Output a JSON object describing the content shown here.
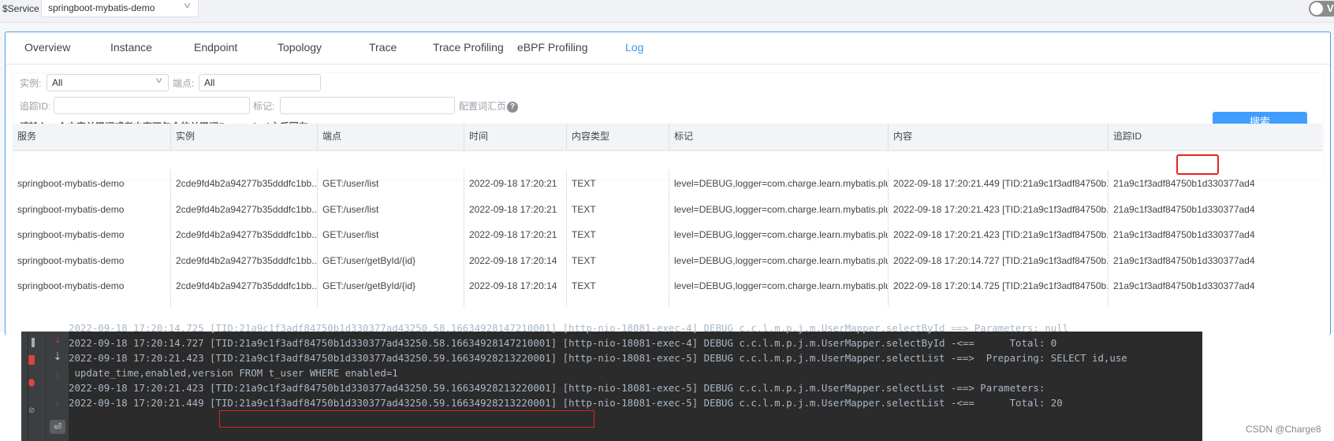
{
  "topbar": {
    "service_label": "$Service",
    "service_value": "springboot-mybatis-demo",
    "toggle_text": "V"
  },
  "tabs": [
    {
      "label": "Overview",
      "active": false
    },
    {
      "label": "Instance",
      "active": false
    },
    {
      "label": "Endpoint",
      "active": false
    },
    {
      "label": "Topology",
      "active": false
    },
    {
      "label": "Trace",
      "active": false
    },
    {
      "label": "Trace Profiling",
      "active": false
    },
    {
      "label": "eBPF Profiling",
      "active": false
    },
    {
      "label": "Log",
      "active": true
    }
  ],
  "accent_color": "#409eff",
  "filters": {
    "instance_label": "实例:",
    "instance_value": "All",
    "endpoint_label": "端点:",
    "endpoint_value": "All",
    "trace_id_label": "追踪ID:",
    "trace_id_value": "",
    "tag_label": "标记:",
    "tag_value": "",
    "vocab_link": "配置词汇页",
    "help_icon": "?",
    "hint": "请输入一个内容关键词或者内容不包含的关键词(key=value)之后回车",
    "search_button": "搜索"
  },
  "table": {
    "columns": [
      "服务",
      "实例",
      "端点",
      "时间",
      "内容类型",
      "标记",
      "内容",
      "追踪ID"
    ],
    "rows": [
      [
        "springboot-mybatis-demo",
        "2cde9fd4b2a94277b35dddfc1bb...",
        "GET:/user/list",
        "2022-09-18 17:20:21",
        "TEXT",
        "level=DEBUG,logger=com.charge.learn.mybatis.plu...",
        "2022-09-18 17:20:21.449 [TID:21a9c1f3adf84750b...",
        "21a9c1f3adf84750b1d330377ad4"
      ],
      [
        "springboot-mybatis-demo",
        "2cde9fd4b2a94277b35dddfc1bb...",
        "GET:/user/list",
        "2022-09-18 17:20:21",
        "TEXT",
        "level=DEBUG,logger=com.charge.learn.mybatis.plu...",
        "2022-09-18 17:20:21.423 [TID:21a9c1f3adf84750b...",
        "21a9c1f3adf84750b1d330377ad4"
      ],
      [
        "springboot-mybatis-demo",
        "2cde9fd4b2a94277b35dddfc1bb...",
        "GET:/user/list",
        "2022-09-18 17:20:21",
        "TEXT",
        "level=DEBUG,logger=com.charge.learn.mybatis.plu...",
        "2022-09-18 17:20:21.423 [TID:21a9c1f3adf84750b...",
        "21a9c1f3adf84750b1d330377ad4"
      ],
      [
        "springboot-mybatis-demo",
        "2cde9fd4b2a94277b35dddfc1bb...",
        "GET:/user/getById/{id}",
        "2022-09-18 17:20:14",
        "TEXT",
        "level=DEBUG,logger=com.charge.learn.mybatis.plu...",
        "2022-09-18 17:20:14.727 [TID:21a9c1f3adf84750b...",
        "21a9c1f3adf84750b1d330377ad4"
      ],
      [
        "springboot-mybatis-demo",
        "2cde9fd4b2a94277b35dddfc1bb...",
        "GET:/user/getById/{id}",
        "2022-09-18 17:20:14",
        "TEXT",
        "level=DEBUG,logger=com.charge.learn.mybatis.plu...",
        "2022-09-18 17:20:14.725 [TID:21a9c1f3adf84750b...",
        "21a9c1f3adf84750b1d330377ad4"
      ]
    ]
  },
  "console": {
    "lines": [
      "2022-09-18 17:20:14.725 [TID:21a9c1f3adf84750b1d330377ad43250.58.16634928147210001] [http-nio-18081-exec-4] DEBUG c.c.l.m.p.j.m.UserMapper.selectById ==> Parameters: null",
      "2022-09-18 17:20:14.727 [TID:21a9c1f3adf84750b1d330377ad43250.58.16634928147210001] [http-nio-18081-exec-4] DEBUG c.c.l.m.p.j.m.UserMapper.selectById -<==      Total: 0",
      "2022-09-18 17:20:21.423 [TID:21a9c1f3adf84750b1d330377ad43250.59.16634928213220001] [http-nio-18081-exec-5] DEBUG c.c.l.m.p.j.m.UserMapper.selectList -==>  Preparing: SELECT id,use",
      " update_time,enabled,version FROM t_user WHERE enabled=1",
      "2022-09-18 17:20:21.423 [TID:21a9c1f3adf84750b1d330377ad43250.59.16634928213220001] [http-nio-18081-exec-5] DEBUG c.c.l.m.p.j.m.UserMapper.selectList -==> Parameters: ",
      "2022-09-18 17:20:21.449 [TID:21a9c1f3adf84750b1d330377ad43250.59.16634928213220001] [http-nio-18081-exec-5] DEBUG c.c.l.m.p.j.m.UserMapper.selectList -<==      Total: 20"
    ],
    "gutter_icons": [
      "scroll-down-arrow",
      "sort-down",
      "up-arrow",
      "down-arrow",
      "soft-wrap"
    ]
  },
  "watermark": "CSDN @Charge8"
}
